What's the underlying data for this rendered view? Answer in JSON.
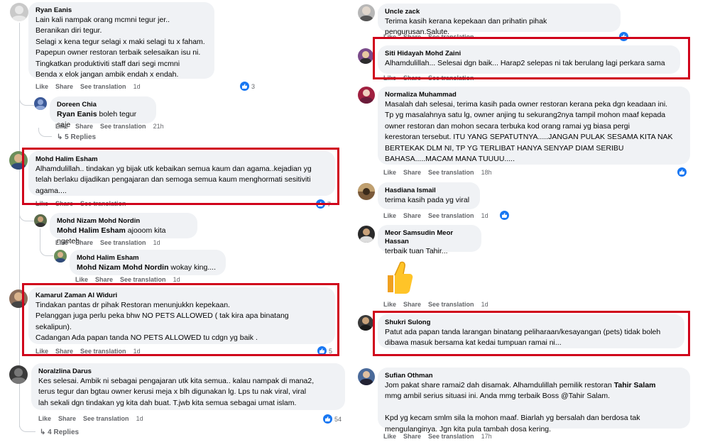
{
  "actions": {
    "like": "Like",
    "share": "Share",
    "translate": "See translation"
  },
  "left": [
    {
      "id": "ryan",
      "name": "Ryan Eanis",
      "text": "Lain kali nampak orang mcmni tegur jer..\nBeranikan diri tegur.\nSelagi x kena tegur selagi x maki selagi tu x faham.\nPapepun owner restoran terbaik selesaikan isu ni.\nTingkatkan produktiviti staff dari segi mcmni\nBenda x elok jangan ambik endah x endah.",
      "time": "1d",
      "reactions": "3"
    },
    {
      "id": "doreen",
      "name": "Doreen Chia",
      "mention": "Ryan Eanis",
      "text": " boleh tegur saje",
      "time": "21h"
    },
    {
      "id": "replies1",
      "label": "5 Replies"
    },
    {
      "id": "halim",
      "name": "Mohd Halim Esham",
      "text": "Alhamdulillah.. tindakan yg bijak utk kebaikan semua kaum dan agama..kejadian yg\ntelah berlaku dijadikan pengajaran dan semoga semua kaum menghormati sesitiviti\nagama....",
      "reactions": "7"
    },
    {
      "id": "nizam",
      "name": "Mohd Nizam Mohd Nordin",
      "mention": "Mohd Halim Esham",
      "text": " ajooom kita ngeteh",
      "time": "1d"
    },
    {
      "id": "halim2",
      "name": "Mohd Halim Esham",
      "mention": "Mohd Nizam Mohd Nordin",
      "text": " wokay king....",
      "time": "1d"
    },
    {
      "id": "kamarul",
      "name": "Kamarul Zaman Al Widuri",
      "text": "Tindakan pantas dr pihak Restoran menunjukkn kepekaan.\nPelanggan juga perlu peka bhw NO PETS ALLOWED ( tak kira apa binatang\nsekalipun).\nCadangan Ada papan tanda NO PETS ALLOWED tu cdgn yg baik .",
      "time": "1d",
      "reactions": "5"
    },
    {
      "id": "noralina",
      "name": "Noralzlina Darus",
      "text": "Kes selesai. Ambik ni sebagai pengajaran utk kita semua.. kalau nampak di mana2,\nterus tegur dan bgtau owner kerusi meja x blh digunakan lg. Lps tu nak viral, viral\nlah sekali dgn tindakan yg kita dah buat. T.jwb kita semua sebagai umat islam.",
      "time": "1d",
      "reactions": "54"
    },
    {
      "id": "replies2",
      "label": "4 Replies"
    }
  ],
  "right": [
    {
      "id": "uncle",
      "name": "Uncle zack",
      "text": "Terima kasih kerana kepekaan dan prihatin pihak pengurusan.Salute."
    },
    {
      "id": "siti",
      "name": "Siti Hidayah Mohd Zaini",
      "text": "Alhamdulillah... Selesai dgn baik... Harap2 selepas ni tak berulang lagi perkara sama"
    },
    {
      "id": "normaliza",
      "name": "Normaliza Muhammad",
      "text": "Masalah dah selesai, terima kasih pada owner restoran kerana peka dgn keadaan ini.\nTp yg masalahnya satu lg, owner anjing tu sekurang2nya tampil mohon maaf kepada\nowner restoran dan mohon secara terbuka kod orang ramai yg biasa pergi\nkerestoran tersebut. ITU YANG SEPATUTNYA.....JANGAN PULAK SESAMA KITA NAK\nBERTEKAK DLM NI, TP YG TERLIBAT HANYA SENYAP DIAM SERIBU\nBAHASA.....MACAM MANA TUUUU.....",
      "time": "18h"
    },
    {
      "id": "hasdiana",
      "name": "Hasdiana Ismail",
      "text": "terima kasih pada yg viral",
      "time": "1d"
    },
    {
      "id": "meor",
      "name": "Meor Samsudin Meor Hassan",
      "text": "terbaik tuan Tahir...",
      "time": "1d"
    },
    {
      "id": "shukri",
      "name": "Shukri Sulong",
      "text": "Patut ada papan tanda larangan binatang peliharaan/kesayangan (pets) tidak boleh\ndibawa masuk bersama kat kedai tumpuan ramai ni..."
    },
    {
      "id": "sufian",
      "name": "Sufian Othman",
      "text1": "Jom pakat share ramai2 dah disamak. Alhamdulillah pemilik restoran ",
      "bold": "Tahir Salam",
      "text2": "\nmmg ambil serius situasi ini. Anda mmg terbaik Boss @Tahir Salam.\n\nKpd yg kecam smlm sila la mohon maaf. Biarlah yg bersalah dan berdosa tak\nmengulanginya. Jgn kita pula tambah dosa kering.",
      "time": "17h"
    }
  ],
  "colors": {
    "highlight": "#d0021b",
    "bubble": "#f0f2f5",
    "like": "#1877f2",
    "meta": "#65676b"
  },
  "icons": [
    "like-reaction-icon",
    "thumbs-up-sticker",
    "avatar"
  ]
}
